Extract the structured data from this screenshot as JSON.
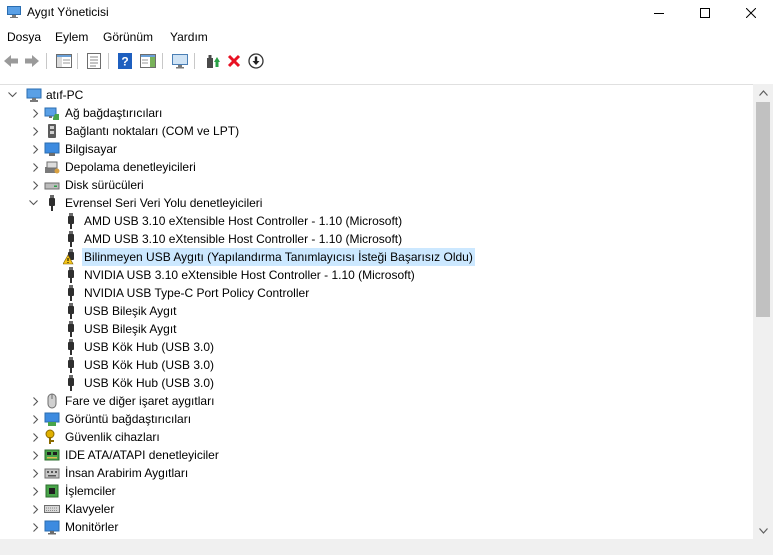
{
  "window": {
    "title": "Aygıt Yöneticisi"
  },
  "menu": [
    "Dosya",
    "Eylem",
    "Görünüm",
    "Yardım"
  ],
  "tree": {
    "root": "atıf-PC",
    "nodes": [
      {
        "label": "Ağ bağdaştırıcıları",
        "icon": "network-adapter-icon",
        "state": "collapsed"
      },
      {
        "label": "Bağlantı noktaları (COM ve LPT)",
        "icon": "port-icon",
        "state": "collapsed"
      },
      {
        "label": "Bilgisayar",
        "icon": "computer-icon",
        "state": "collapsed"
      },
      {
        "label": "Depolama denetleyicileri",
        "icon": "storage-controller-icon",
        "state": "collapsed"
      },
      {
        "label": "Disk sürücüleri",
        "icon": "disk-drive-icon",
        "state": "collapsed"
      },
      {
        "label": "Evrensel Seri Veri Yolu denetleyicileri",
        "icon": "usb-icon",
        "state": "expanded",
        "children": [
          {
            "label": "AMD USB 3.10 eXtensible Host Controller - 1.10 (Microsoft)",
            "icon": "usb-icon"
          },
          {
            "label": "AMD USB 3.10 eXtensible Host Controller - 1.10 (Microsoft)",
            "icon": "usb-icon"
          },
          {
            "label": "Bilinmeyen USB Aygıtı (Yapılandırma Tanımlayıcısı İsteği Başarısız Oldu)",
            "icon": "warning-icon",
            "selected": true
          },
          {
            "label": "NVIDIA USB 3.10 eXtensible Host Controller - 1.10 (Microsoft)",
            "icon": "usb-icon"
          },
          {
            "label": "NVIDIA USB Type-C Port Policy Controller",
            "icon": "usb-icon"
          },
          {
            "label": "USB Bileşik Aygıt",
            "icon": "usb-icon"
          },
          {
            "label": "USB Bileşik Aygıt",
            "icon": "usb-icon"
          },
          {
            "label": "USB Kök Hub (USB 3.0)",
            "icon": "usb-icon"
          },
          {
            "label": "USB Kök Hub (USB 3.0)",
            "icon": "usb-icon"
          },
          {
            "label": "USB Kök Hub (USB 3.0)",
            "icon": "usb-icon"
          }
        ]
      },
      {
        "label": "Fare ve diğer işaret aygıtları",
        "icon": "mouse-icon",
        "state": "collapsed"
      },
      {
        "label": "Görüntü bağdaştırıcıları",
        "icon": "display-adapter-icon",
        "state": "collapsed"
      },
      {
        "label": "Güvenlik cihazları",
        "icon": "security-device-icon",
        "state": "collapsed"
      },
      {
        "label": "IDE ATA/ATAPI denetleyiciler",
        "icon": "ide-controller-icon",
        "state": "collapsed"
      },
      {
        "label": "İnsan Arabirim Aygıtları",
        "icon": "hid-icon",
        "state": "collapsed"
      },
      {
        "label": "İşlemciler",
        "icon": "processor-icon",
        "state": "collapsed"
      },
      {
        "label": "Klavyeler",
        "icon": "keyboard-icon",
        "state": "collapsed"
      },
      {
        "label": "Monitörler",
        "icon": "monitor-icon",
        "state": "collapsed"
      }
    ]
  },
  "colors": {
    "selection": "#cce8ff",
    "delete_red": "#e81123",
    "help_blue": "#1e5fbf",
    "warning_yellow": "#f5c518"
  }
}
